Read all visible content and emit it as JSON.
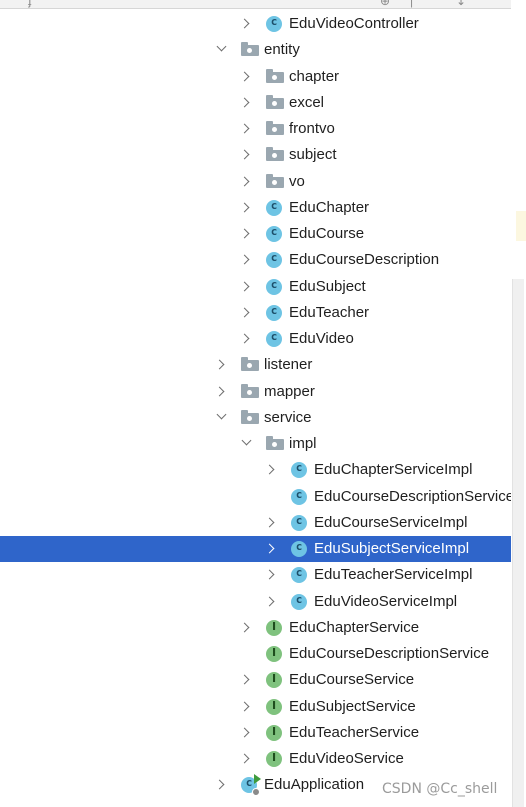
{
  "tree": {
    "rows": [
      {
        "label": "EduVideoController",
        "indent": 2,
        "arrow": "right",
        "icon": "class-icon"
      },
      {
        "label": "entity",
        "indent": 1,
        "arrow": "down",
        "icon": "folder-icon"
      },
      {
        "label": "chapter",
        "indent": 2,
        "arrow": "right",
        "icon": "folder-icon"
      },
      {
        "label": "excel",
        "indent": 2,
        "arrow": "right",
        "icon": "folder-icon"
      },
      {
        "label": "frontvo",
        "indent": 2,
        "arrow": "right",
        "icon": "folder-icon"
      },
      {
        "label": "subject",
        "indent": 2,
        "arrow": "right",
        "icon": "folder-icon"
      },
      {
        "label": "vo",
        "indent": 2,
        "arrow": "right",
        "icon": "folder-icon"
      },
      {
        "label": "EduChapter",
        "indent": 2,
        "arrow": "right",
        "icon": "class-icon"
      },
      {
        "label": "EduCourse",
        "indent": 2,
        "arrow": "right",
        "icon": "class-icon"
      },
      {
        "label": "EduCourseDescription",
        "indent": 2,
        "arrow": "right",
        "icon": "class-icon"
      },
      {
        "label": "EduSubject",
        "indent": 2,
        "arrow": "right",
        "icon": "class-icon"
      },
      {
        "label": "EduTeacher",
        "indent": 2,
        "arrow": "right",
        "icon": "class-icon"
      },
      {
        "label": "EduVideo",
        "indent": 2,
        "arrow": "right",
        "icon": "class-icon"
      },
      {
        "label": "listener",
        "indent": 1,
        "arrow": "right",
        "icon": "folder-icon"
      },
      {
        "label": "mapper",
        "indent": 1,
        "arrow": "right",
        "icon": "folder-icon"
      },
      {
        "label": "service",
        "indent": 1,
        "arrow": "down",
        "icon": "folder-icon"
      },
      {
        "label": "impl",
        "indent": 2,
        "arrow": "down",
        "icon": "folder-icon"
      },
      {
        "label": "EduChapterServiceImpl",
        "indent": 3,
        "arrow": "right",
        "icon": "class-icon"
      },
      {
        "label": "EduCourseDescriptionServiceImpl",
        "indent": 3,
        "arrow": "none",
        "icon": "class-icon"
      },
      {
        "label": "EduCourseServiceImpl",
        "indent": 3,
        "arrow": "right",
        "icon": "class-icon"
      },
      {
        "label": "EduSubjectServiceImpl",
        "indent": 3,
        "arrow": "right",
        "icon": "class-icon",
        "selected": true
      },
      {
        "label": "EduTeacherServiceImpl",
        "indent": 3,
        "arrow": "right",
        "icon": "class-icon"
      },
      {
        "label": "EduVideoServiceImpl",
        "indent": 3,
        "arrow": "right",
        "icon": "class-icon"
      },
      {
        "label": "EduChapterService",
        "indent": 2,
        "arrow": "right",
        "icon": "interface-icon"
      },
      {
        "label": "EduCourseDescriptionService",
        "indent": 2,
        "arrow": "none",
        "icon": "interface-icon"
      },
      {
        "label": "EduCourseService",
        "indent": 2,
        "arrow": "right",
        "icon": "interface-icon"
      },
      {
        "label": "EduSubjectService",
        "indent": 2,
        "arrow": "right",
        "icon": "interface-icon"
      },
      {
        "label": "EduTeacherService",
        "indent": 2,
        "arrow": "right",
        "icon": "interface-icon"
      },
      {
        "label": "EduVideoService",
        "indent": 2,
        "arrow": "right",
        "icon": "interface-icon"
      },
      {
        "label": "EduApplication",
        "indent": 1,
        "arrow": "right",
        "icon": "app-icon"
      }
    ]
  },
  "watermark": "CSDN @Cc_shell",
  "colors": {
    "selection": "#2f65ca",
    "class_icon": "#6ec4e4",
    "interface_icon": "#7fc27e",
    "folder_icon": "#9aa7b0"
  }
}
